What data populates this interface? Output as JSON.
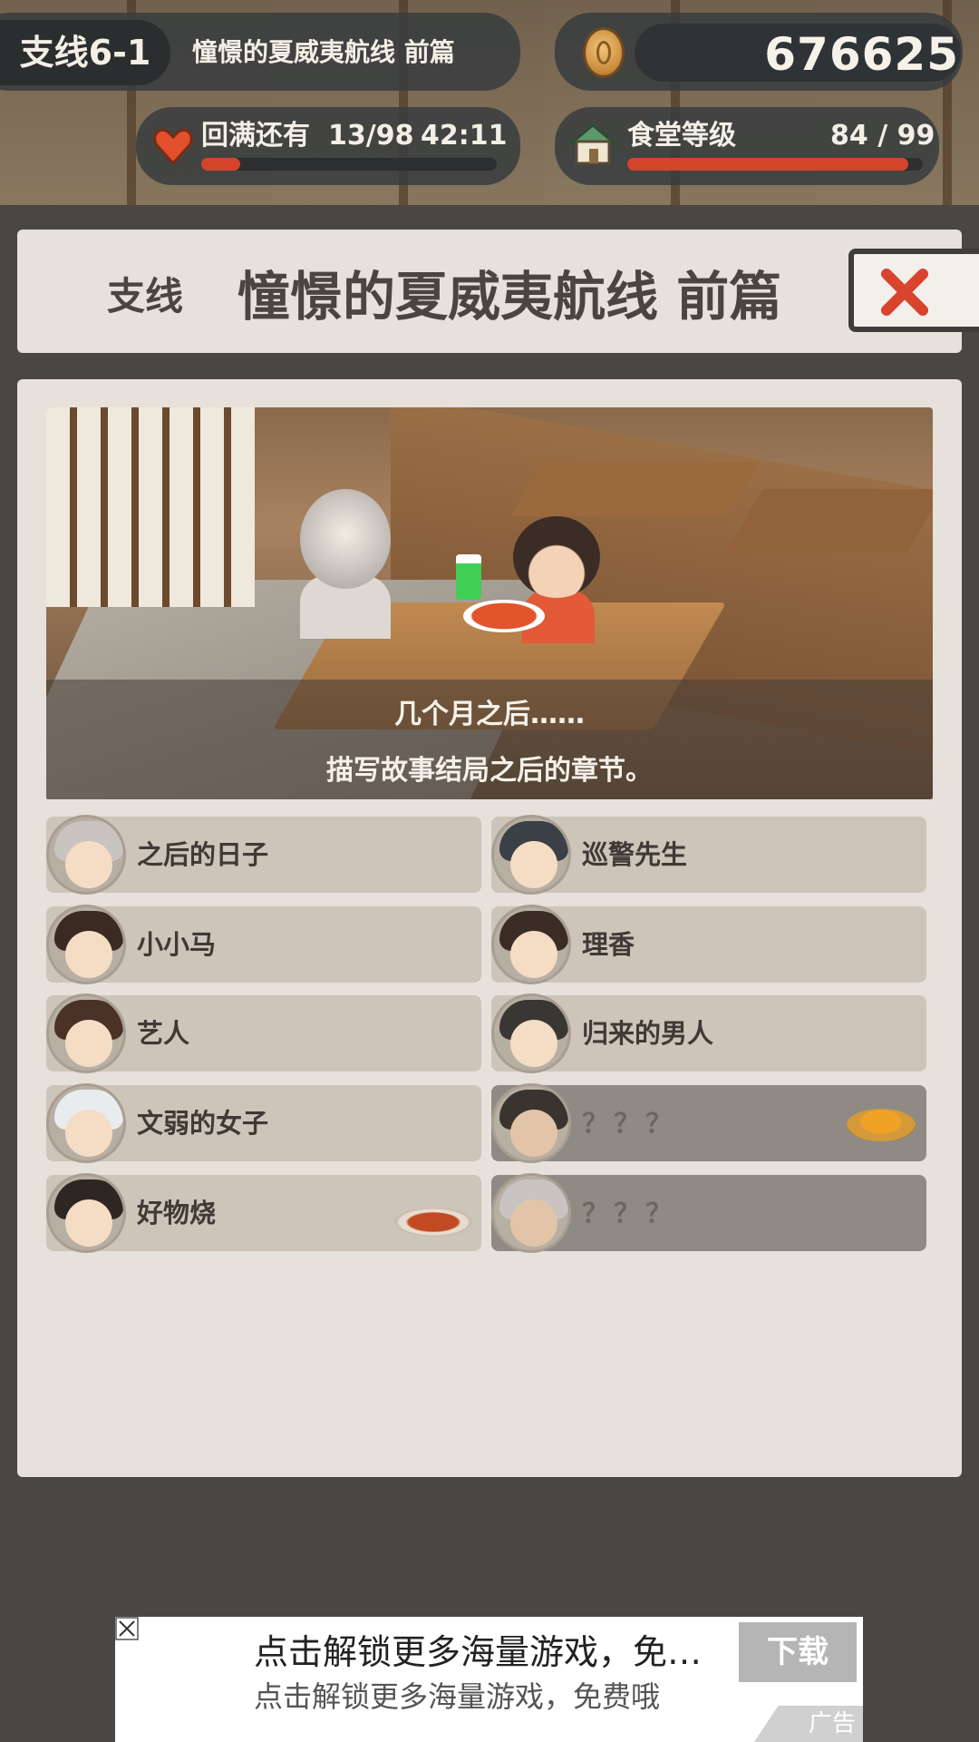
{
  "hud": {
    "chapter_tag": "支线6-1",
    "chapter_name": "憧憬的夏威夷航线 前篇",
    "coins": "676625",
    "stamina_label": "回满还有",
    "stamina_value": "13/98",
    "stamina_timer": "42:11",
    "stamina_fraction": 0.133,
    "level_label": "食堂等级",
    "level_value": "84 / 99",
    "level_fraction": 0.95,
    "accent_color": "#d4442c"
  },
  "title": {
    "kind": "支线",
    "main": "憧憬的夏威夷航线 前篇",
    "close_icon": "close-x-icon"
  },
  "scene": {
    "caption_line1": "几个月之后……",
    "caption_line2": "描写故事结局之后的章节。"
  },
  "stories": [
    {
      "label": "之后的日子",
      "locked": false
    },
    {
      "label": "巡警先生",
      "locked": false
    },
    {
      "label": "小小马",
      "locked": false
    },
    {
      "label": "理香",
      "locked": false
    },
    {
      "label": "艺人",
      "locked": false
    },
    {
      "label": "归来的男人",
      "locked": false
    },
    {
      "label": "文弱的女子",
      "locked": false
    },
    {
      "label": "？？？",
      "locked": true
    },
    {
      "label": "好物烧",
      "locked": false
    },
    {
      "label": "？？？",
      "locked": true
    }
  ],
  "ad": {
    "title": "点击解锁更多海量游戏，免…",
    "subtitle": "点击解锁更多海量游戏，免费哦",
    "button": "下载",
    "tag": "广告"
  }
}
